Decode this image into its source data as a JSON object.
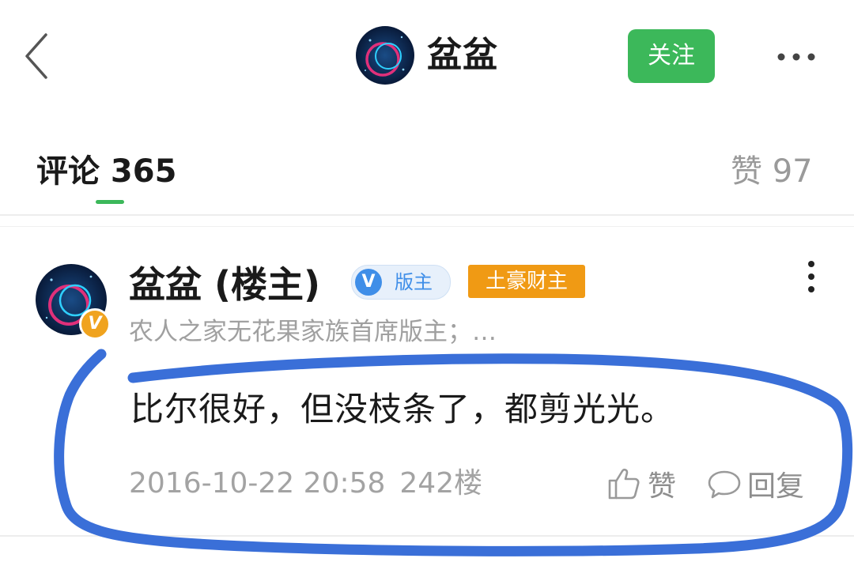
{
  "header": {
    "title": "盆盆",
    "follow_label": "关注",
    "icons": {
      "back": "back-arrow-icon",
      "more": "more-horizontal-icon"
    }
  },
  "tabs": {
    "comments_label": "评论 365",
    "likes_label": "赞 97"
  },
  "comment": {
    "author": "盆盆 (楼主)",
    "verified_badge": "V",
    "moderator_badge_icon": "V",
    "moderator_badge_label": "版主",
    "rank_badge": "土豪财主",
    "author_title": "农人之家无花果家族首席版主；…",
    "text": "比尔很好，但没枝条了，都剪光光。",
    "date": "2016-10-22 20:58",
    "floor": "242楼",
    "like_label": "赞",
    "reply_label": "回复"
  },
  "colors": {
    "accent_green": "#3cb85a",
    "badge_blue": "#3f8ee8",
    "badge_orange": "#f09a14",
    "annotation_blue": "#3a6fd8"
  }
}
